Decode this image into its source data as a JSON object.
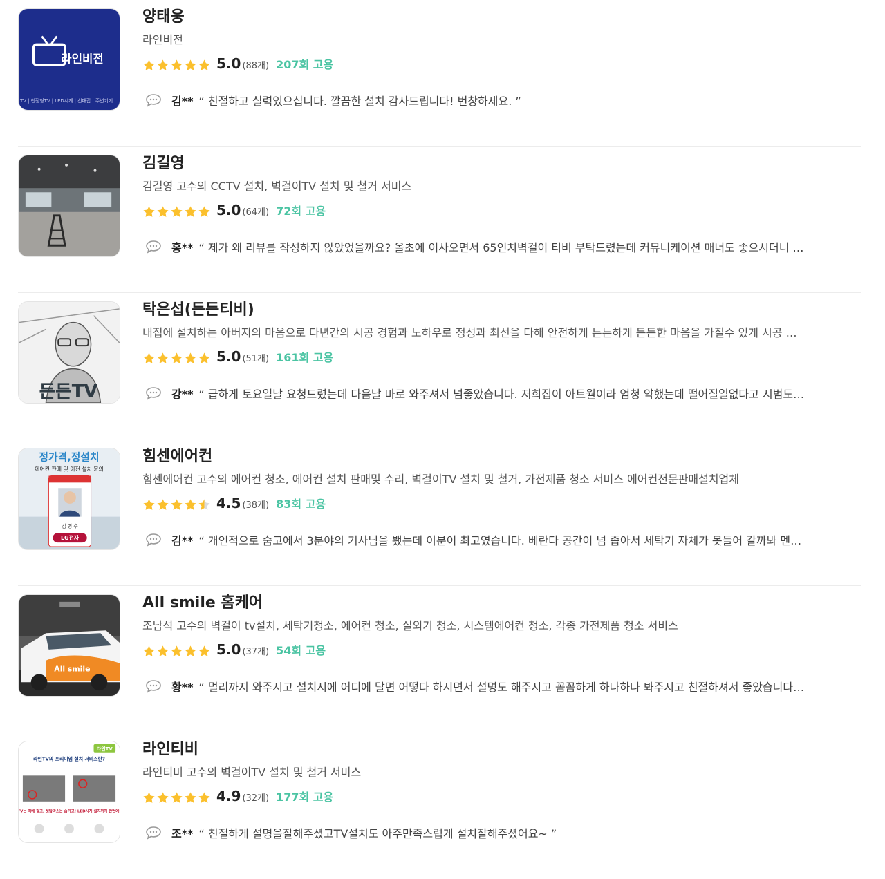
{
  "colors": {
    "accent": "#4bc4a3",
    "star": "#fbc02d",
    "divider": "#ececec"
  },
  "providers": [
    {
      "name": "양태웅",
      "description": "라인비전",
      "rating": "5.0",
      "stars": 5,
      "review_count": "(88개)",
      "hires": "207회 고용",
      "reviewer": "김**",
      "review": "“ 친절하고 실력있으십니다. 깔끔한 설치 감사드립니다! 번창하세요. ”",
      "thumb_text": "라인비전",
      "thumb_caption": "TV | 천정형TV | LED시계 | 선매립 | 주변기기"
    },
    {
      "name": "김길영",
      "description": "김길영 고수의 CCTV 설치, 벽걸이TV 설치 및 철거 서비스",
      "rating": "5.0",
      "stars": 5,
      "review_count": "(64개)",
      "hires": "72회 고용",
      "reviewer": "홍**",
      "review": "“ 제가 왜 리뷰를 작성하지 않았었을까요? 올초에 이사오면서 65인치벽걸이 티비 부탁드렸는데 커뮤니케이션 매너도 좋으시더니 …"
    },
    {
      "name": "탁은섭(든든티비)",
      "description": "내집에 설치하는 아버지의 마음으로 다년간의 시공 경험과 노하우로 정성과 최선을 다해 안전하게 튼튼하게 든든한 마음을 가질수 있게 시공 …",
      "rating": "5.0",
      "stars": 5,
      "review_count": "(51개)",
      "hires": "161회 고용",
      "reviewer": "강**",
      "review": "“ 급하게 토요일날 요청드렸는데 다음날 바로 와주셔서 넘좋았습니다. 저희집이 아트월이라 엄청 약했는데 떨어질일없다고 시범도…",
      "thumb_text": "든든TV"
    },
    {
      "name": "힘센에어컨",
      "description": "힘센에어컨 고수의 에어컨 청소, 에어컨 설치 판매및 수리, 벽걸이TV 설치 및 철거, 가전제품 청소 서비스 에어컨전문판매설치업체",
      "rating": "4.5",
      "stars": 4.5,
      "review_count": "(38개)",
      "hires": "83회 고용",
      "reviewer": "김**",
      "review": "“ 개인적으로 숨고에서 3분야의 기사님을 뵀는데 이분이 최고였습니다. 베란다 공간이 넘 좁아서 세탁기 자체가 못들어 갈까봐 멘…",
      "thumb_title": "정가격,정설치",
      "thumb_sub": "에어컨 판매 및 이전 설치 문의",
      "thumb_badge_name": "김 병 수",
      "thumb_badge_brand": "LG전자"
    },
    {
      "name": "All smile 홈케어",
      "description": "조남석 고수의 벽걸이 tv설치, 세탁기청소, 에어컨 청소, 실외기 청소, 시스템에어컨 청소, 각종 가전제품 청소 서비스",
      "rating": "5.0",
      "stars": 5,
      "review_count": "(37개)",
      "hires": "54회 고용",
      "reviewer": "황**",
      "review": "“ 멀리까지 와주시고 설치시에 어디에 달면 어떻다 하시면서 설명도 해주시고 꼼꼼하게 하나하나 봐주시고 친절하셔서 좋았습니다…",
      "thumb_text": "All smile"
    },
    {
      "name": "라인티비",
      "description": "라인티비 고수의 벽걸이TV 설치 및 철거 서비스",
      "rating": "4.9",
      "stars": 5,
      "review_count": "(32개)",
      "hires": "177회 고용",
      "reviewer": "조**",
      "review": "“ 친절하게 설명을잘해주셨고TV설치도 아주만족스럽게 설치잘해주셨어요~ ”",
      "thumb_brand": "라인TV",
      "thumb_title": "라인TV의 프리미엄 설치 서비스란?",
      "thumb_line": "TV는 벽에 걸고, 셋탑박스는 숨기고! LED시계 설치까지 한번에!"
    }
  ]
}
